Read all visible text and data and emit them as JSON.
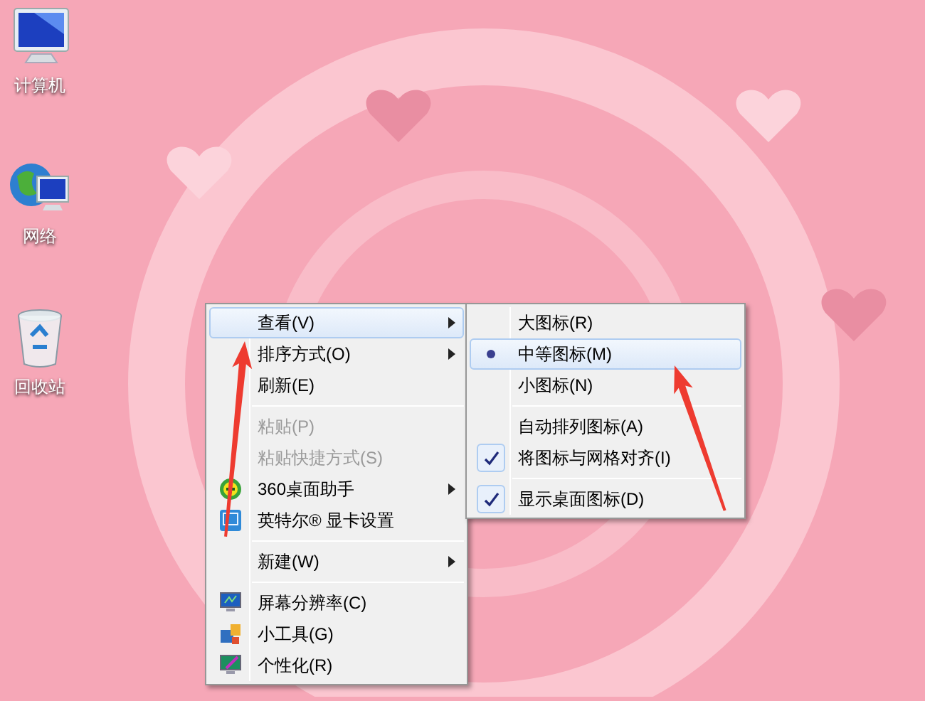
{
  "desktop_icons": [
    {
      "label": "计算机"
    },
    {
      "label": "网络"
    },
    {
      "label": "回收站"
    }
  ],
  "context_menu": {
    "items": [
      {
        "kind": "item",
        "label": "查看(V)",
        "submenu": true,
        "disabled": false,
        "selected": true
      },
      {
        "kind": "item",
        "label": "排序方式(O)",
        "submenu": true,
        "disabled": false,
        "selected": false
      },
      {
        "kind": "item",
        "label": "刷新(E)",
        "submenu": false,
        "disabled": false,
        "selected": false
      },
      {
        "kind": "separator"
      },
      {
        "kind": "item",
        "label": "粘贴(P)",
        "submenu": false,
        "disabled": true,
        "selected": false
      },
      {
        "kind": "item",
        "label": "粘贴快捷方式(S)",
        "submenu": false,
        "disabled": true,
        "selected": false
      },
      {
        "kind": "item",
        "label": "360桌面助手",
        "submenu": true,
        "disabled": false,
        "selected": false
      },
      {
        "kind": "item",
        "label": "英特尔® 显卡设置",
        "submenu": false,
        "disabled": false,
        "selected": false
      },
      {
        "kind": "separator"
      },
      {
        "kind": "item",
        "label": "新建(W)",
        "submenu": true,
        "disabled": false,
        "selected": false
      },
      {
        "kind": "separator"
      },
      {
        "kind": "item",
        "label": "屏幕分辨率(C)",
        "submenu": false,
        "disabled": false,
        "selected": false
      },
      {
        "kind": "item",
        "label": "小工具(G)",
        "submenu": false,
        "disabled": false,
        "selected": false
      },
      {
        "kind": "item",
        "label": "个性化(R)",
        "submenu": false,
        "disabled": false,
        "selected": false
      }
    ]
  },
  "view_submenu": {
    "items": [
      {
        "kind": "radio",
        "label": "大图标(R)",
        "checked": false,
        "selected": false
      },
      {
        "kind": "radio",
        "label": "中等图标(M)",
        "checked": true,
        "selected": true
      },
      {
        "kind": "radio",
        "label": "小图标(N)",
        "checked": false,
        "selected": false
      },
      {
        "kind": "separator"
      },
      {
        "kind": "check",
        "label": "自动排列图标(A)",
        "checked": false,
        "selected": false
      },
      {
        "kind": "check",
        "label": "将图标与网格对齐(I)",
        "checked": true,
        "selected": false
      },
      {
        "kind": "separator"
      },
      {
        "kind": "check",
        "label": "显示桌面图标(D)",
        "checked": true,
        "selected": false
      }
    ]
  }
}
